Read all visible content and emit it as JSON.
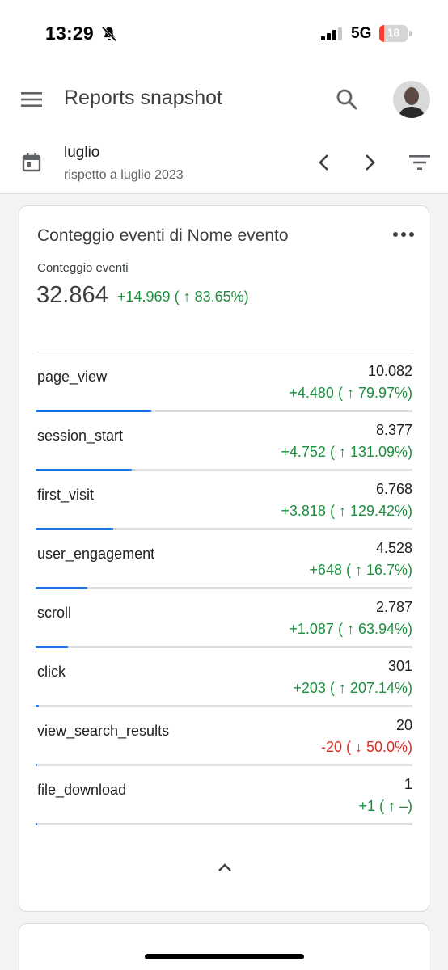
{
  "status_bar": {
    "time": "13:29",
    "network": "5G",
    "battery_level": "18",
    "battery_fraction": 0.18,
    "icons": [
      "bell-off-icon",
      "signal-icon",
      "battery-icon"
    ]
  },
  "app_bar": {
    "title": "Reports snapshot",
    "icons": [
      "menu-icon",
      "search-icon",
      "avatar"
    ]
  },
  "date_range": {
    "period": "luglio",
    "comparison": "rispetto a luglio 2023",
    "icons": [
      "calendar-icon",
      "chevron-left-icon",
      "chevron-right-icon",
      "filter-icon"
    ]
  },
  "colors": {
    "positive": "#1e8e3e",
    "negative": "#d93025",
    "bar": "#1a73e8",
    "track": "#dadce0"
  },
  "card": {
    "title": "Conteggio eventi di Nome evento",
    "metric_label": "Conteggio eventi",
    "metric_value": "32.864",
    "metric_change": "+14.969 ( ↑ 83.65%)",
    "rows": [
      {
        "name": "page_view",
        "value": "10.082",
        "change": "+4.480 ( ↑ 79.97%)",
        "direction": "up",
        "share": 10082
      },
      {
        "name": "session_start",
        "value": "8.377",
        "change": "+4.752 ( ↑ 131.09%)",
        "direction": "up",
        "share": 8377
      },
      {
        "name": "first_visit",
        "value": "6.768",
        "change": "+3.818 ( ↑ 129.42%)",
        "direction": "up",
        "share": 6768
      },
      {
        "name": "user_engagement",
        "value": "4.528",
        "change": "+648 ( ↑ 16.7%)",
        "direction": "up",
        "share": 4528
      },
      {
        "name": "scroll",
        "value": "2.787",
        "change": "+1.087 ( ↑ 63.94%)",
        "direction": "up",
        "share": 2787
      },
      {
        "name": "click",
        "value": "301",
        "change": "+203 ( ↑ 207.14%)",
        "direction": "up",
        "share": 301
      },
      {
        "name": "view_search_results",
        "value": "20",
        "change": "-20 ( ↓ 50.0%)",
        "direction": "down",
        "share": 20
      },
      {
        "name": "file_download",
        "value": "1",
        "change": "+1 ( ↑ –)",
        "direction": "up",
        "share": 1
      }
    ]
  }
}
